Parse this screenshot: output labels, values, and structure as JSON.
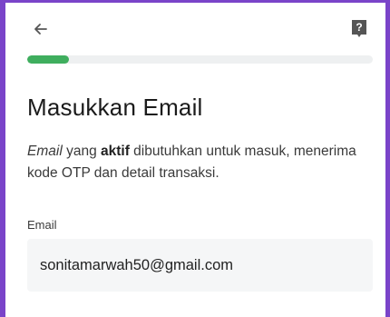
{
  "header": {
    "back_icon": "arrow-left-icon",
    "help_icon": "question-badge-icon"
  },
  "progress": {
    "value": 0.12,
    "color": "#3fae5e"
  },
  "page": {
    "title": "Masukkan Email",
    "description": {
      "part1": "Email",
      "part2": " yang ",
      "part3": "aktif",
      "part4": " dibutuhkan untuk masuk, menerima kode OTP dan detail transaksi."
    }
  },
  "form": {
    "email_label": "Email",
    "email_value": "sonitamarwah50@gmail.com"
  },
  "colors": {
    "accent": "#7a44c9",
    "progress": "#3fae5e"
  }
}
